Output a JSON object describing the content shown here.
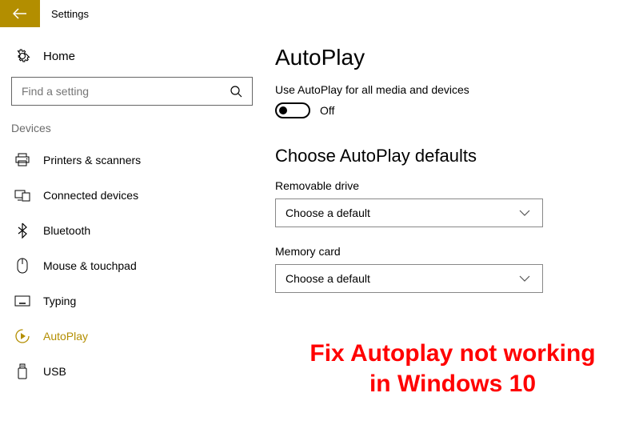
{
  "header": {
    "title": "Settings"
  },
  "sidebar": {
    "home_label": "Home",
    "search_placeholder": "Find a setting",
    "category_label": "Devices",
    "items": [
      {
        "label": "Printers & scanners"
      },
      {
        "label": "Connected devices"
      },
      {
        "label": "Bluetooth"
      },
      {
        "label": "Mouse & touchpad"
      },
      {
        "label": "Typing"
      },
      {
        "label": "AutoPlay"
      },
      {
        "label": "USB"
      }
    ]
  },
  "main": {
    "title": "AutoPlay",
    "toggle_label": "Use AutoPlay for all media and devices",
    "toggle_state": "Off",
    "defaults_heading": "Choose AutoPlay defaults",
    "removable_label": "Removable drive",
    "removable_value": "Choose a default",
    "memory_label": "Memory card",
    "memory_value": "Choose a default"
  },
  "overlay": {
    "line1": "Fix Autoplay not working",
    "line2": "in Windows 10"
  }
}
